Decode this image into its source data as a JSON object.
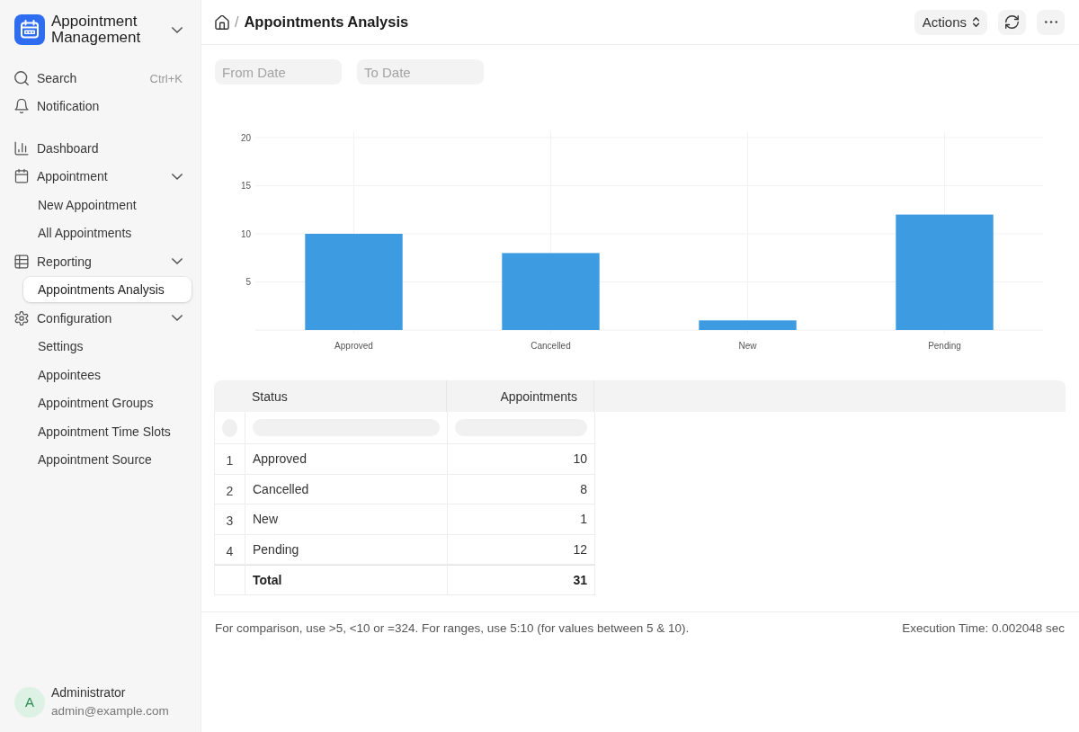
{
  "sidebar": {
    "app_switcher": {
      "title": "Appointment Management"
    },
    "search": {
      "label": "Search",
      "shortcut": "Ctrl+K"
    },
    "notification": {
      "label": "Notification"
    },
    "items": [
      {
        "kind": "link",
        "label": "Dashboard",
        "selected": false
      },
      {
        "kind": "group",
        "label": "Appointment",
        "selected": false,
        "expanded": true,
        "children": [
          {
            "label": "New Appointment",
            "selected": false
          },
          {
            "label": "All Appointments",
            "selected": false
          }
        ]
      },
      {
        "kind": "group",
        "label": "Reporting",
        "selected": false,
        "expanded": true,
        "children": [
          {
            "label": "Appointments Analysis",
            "selected": true
          }
        ]
      },
      {
        "kind": "group",
        "label": "Configuration",
        "selected": false,
        "expanded": true,
        "children": [
          {
            "label": "Settings",
            "selected": false
          },
          {
            "label": "Appointees",
            "selected": false
          },
          {
            "label": "Appointment Groups",
            "selected": false
          },
          {
            "label": "Appointment Time Slots",
            "selected": false
          },
          {
            "label": "Appointment Source",
            "selected": false
          }
        ]
      }
    ],
    "user": {
      "initial": "A",
      "name": "Administrator",
      "email": "admin@example.com"
    }
  },
  "header": {
    "breadcrumb_separator": "/",
    "title": "Appointments Analysis",
    "actions_button": "Actions"
  },
  "filters": [
    {
      "placeholder": "From Date"
    },
    {
      "placeholder": "To Date"
    }
  ],
  "chart": {
    "chart_data": {
      "type": "bar",
      "categories": [
        "Approved",
        "Cancelled",
        "New",
        "Pending"
      ],
      "series": [
        {
          "color": "#3d9be2",
          "values": [
            10,
            8,
            1,
            12
          ]
        }
      ],
      "ylim": [
        0,
        20
      ],
      "yticks": [
        5,
        10,
        15,
        20
      ],
      "grid": true
    }
  },
  "table": {
    "columns": [
      {
        "kind": "text",
        "label": "Status"
      },
      {
        "kind": "number",
        "label": "Appointments"
      }
    ],
    "rows": [
      {
        "index": "1",
        "cells": [
          "Approved",
          "10"
        ]
      },
      {
        "index": "2",
        "cells": [
          "Cancelled",
          "8"
        ]
      },
      {
        "index": "3",
        "cells": [
          "New",
          "1"
        ]
      },
      {
        "index": "4",
        "cells": [
          "Pending",
          "12"
        ]
      }
    ],
    "total": {
      "cells": [
        "Total",
        "31"
      ]
    }
  },
  "footer": {
    "hint": "For comparison, use >5, <10 or =324. For ranges, use 5:10 (for values between 5 & 10).",
    "execution_time": "Execution Time: 0.002048 sec"
  }
}
